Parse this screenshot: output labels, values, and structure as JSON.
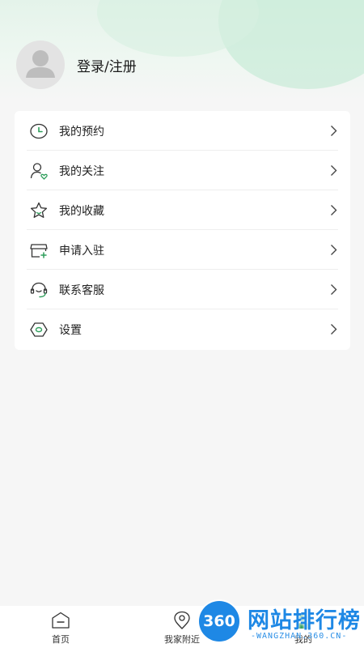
{
  "profile": {
    "login_label": "登录/注册",
    "avatar_icon": "default-user-avatar"
  },
  "colors": {
    "accent": "#2e9e5b",
    "icon_stroke": "#333333",
    "watermark_blue": "#1e88e5",
    "background": "#f6f6f6"
  },
  "menu": {
    "items": [
      {
        "label": "我的预约",
        "icon": "clock-icon"
      },
      {
        "label": "我的关注",
        "icon": "user-heart-icon"
      },
      {
        "label": "我的收藏",
        "icon": "star-icon"
      },
      {
        "label": "申请入驻",
        "icon": "storefront-add-icon"
      },
      {
        "label": "联系客服",
        "icon": "headset-icon"
      },
      {
        "label": "设置",
        "icon": "settings-hexagon-icon"
      }
    ]
  },
  "tabbar": {
    "tabs": [
      {
        "label": "首页",
        "icon": "home-icon"
      },
      {
        "label": "我家附近",
        "icon": "location-pin-icon"
      },
      {
        "label": "我的",
        "icon": "profile-icon",
        "active": true
      }
    ]
  },
  "watermark": {
    "badge": "360",
    "title": "网站排行榜",
    "subtitle": "-WANGZHAN.360.CN-"
  }
}
